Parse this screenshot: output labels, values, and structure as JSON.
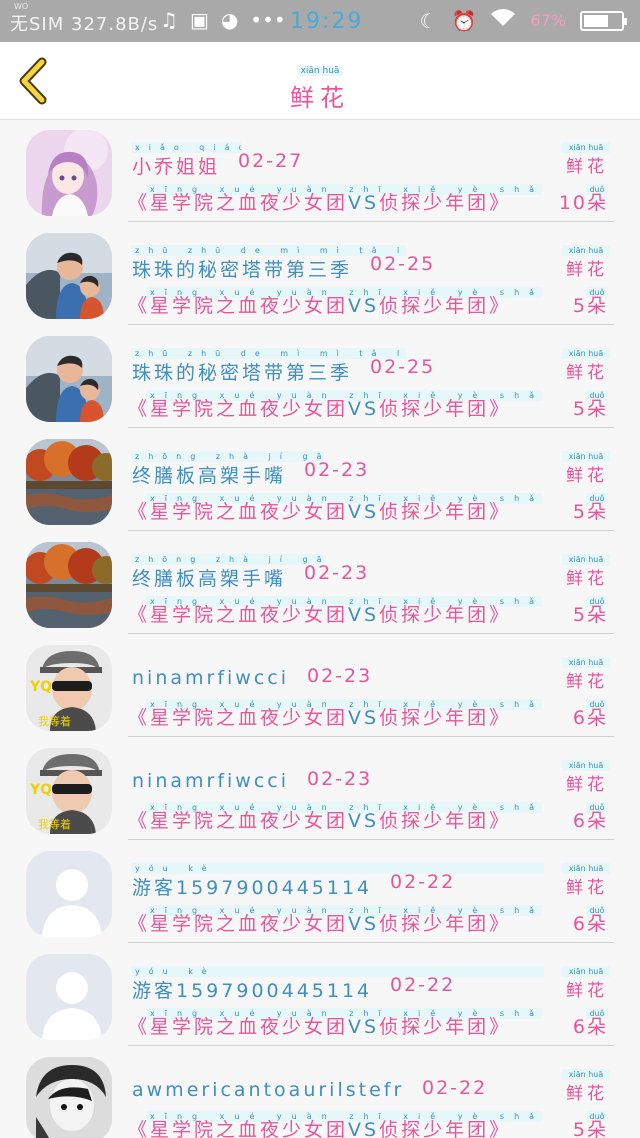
{
  "status_bar": {
    "net_small": "WO",
    "carrier": "无SIM 327.8B/s",
    "time": "19:29",
    "battery_text": "67%",
    "battery_level": 0.67,
    "icons": [
      "music-icon",
      "bag-icon",
      "palette-icon",
      "more-dots-icon",
      "moon-icon",
      "alarm-icon",
      "wifi-icon",
      "battery-icon"
    ]
  },
  "header": {
    "title_pinyin": "xiān  huā",
    "title": "鲜花"
  },
  "labels": {
    "xh_pinyin": "xiān  huā",
    "xh": "鲜花",
    "dou_pinyin": "duǒ"
  },
  "rows": [
    {
      "name": "小乔姐姐",
      "name_pinyin": "xiǎo qiáo jiě jiě",
      "date": "02-27",
      "book": [
        "《星学院之血夜少女团",
        "VS",
        "侦探少年团》"
      ],
      "book_pinyin": "xīng xué yuàn zhī xiě yè shǎo nǚ tuán  zhēn tàn shǎo nián tuán",
      "count": "10朵",
      "avatar": "anime",
      "name_color": "pink"
    },
    {
      "name": "珠珠的秘密塔带第三季",
      "name_pinyin": "zhū zhū de mì mì tǎ luò dì sān jì",
      "date": "02-25",
      "book": [
        "《星学院之血夜少女团",
        "VS",
        "侦探少年团》"
      ],
      "book_pinyin": "xīng xué yuàn zhī xiě yè shǎo nǚ tuán  zhēn tàn shǎo nián tuán",
      "count": "5朵",
      "avatar": "kids",
      "name_color": "blue"
    },
    {
      "name": "珠珠的秘密塔带第三季",
      "name_pinyin": "zhū zhū de mì mì tǎ luò dì sān jì",
      "date": "02-25",
      "book": [
        "《星学院之血夜少女团",
        "VS",
        "侦探少年团》"
      ],
      "book_pinyin": "xīng xué yuàn zhī xiě yè shǎo nǚ tuán  zhēn tàn shǎo nián tuán",
      "count": "5朵",
      "avatar": "kids",
      "name_color": "blue"
    },
    {
      "name": "终膳板高槊手嘴",
      "name_pinyin": "zhōng zhà jí gāo jǔ shǒu rú",
      "date": "02-23",
      "book": [
        "《星学院之血夜少女团",
        "VS",
        "侦探少年团》"
      ],
      "book_pinyin": "xīng xué yuàn zhī xiě yè shǎo nǚ tuán  zhēn tàn shǎo nián tuán",
      "count": "5朵",
      "avatar": "autumn",
      "name_color": "blue"
    },
    {
      "name": "终膳板高槊手嘴",
      "name_pinyin": "zhōng zhà jí gāo jǔ shǒu rú",
      "date": "02-23",
      "book": [
        "《星学院之血夜少女团",
        "VS",
        "侦探少年团》"
      ],
      "book_pinyin": "xīng xué yuàn zhī xiě yè shǎo nǚ tuán  zhēn tàn shǎo nián tuán",
      "count": "5朵",
      "avatar": "autumn",
      "name_color": "blue"
    },
    {
      "name": "ninamrfiwcci",
      "name_pinyin": "",
      "date": "02-23",
      "book": [
        "《星学院之血夜少女团",
        "VS",
        "侦探少年团》"
      ],
      "book_pinyin": "xīng xué yuàn zhī xiě yè shǎo nǚ tuán  zhēn tàn shǎo nián tuán",
      "count": "6朵",
      "avatar": "yq",
      "name_color": "blue"
    },
    {
      "name": "ninamrfiwcci",
      "name_pinyin": "",
      "date": "02-23",
      "book": [
        "《星学院之血夜少女团",
        "VS",
        "侦探少年团》"
      ],
      "book_pinyin": "xīng xué yuàn zhī xiě yè shǎo nǚ tuán  zhēn tàn shǎo nián tuán",
      "count": "6朵",
      "avatar": "yq",
      "name_color": "blue"
    },
    {
      "name": "游客1597900445114",
      "name_pinyin": "yóu kè",
      "date": "02-22",
      "book": [
        "《星学院之血夜少女团",
        "VS",
        "侦探少年团》"
      ],
      "book_pinyin": "xīng xué yuàn zhī xiě yè shǎo nǚ tuán  zhēn tàn shǎo nián tuán",
      "count": "6朵",
      "avatar": "default",
      "name_color": "blue"
    },
    {
      "name": "游客1597900445114",
      "name_pinyin": "yóu kè",
      "date": "02-22",
      "book": [
        "《星学院之血夜少女团",
        "VS",
        "侦探少年团》"
      ],
      "book_pinyin": "xīng xué yuàn zhī xiě yè shǎo nǚ tuán  zhēn tàn shǎo nián tuán",
      "count": "6朵",
      "avatar": "default",
      "name_color": "blue"
    },
    {
      "name": "awmericantoaurilstefr",
      "name_pinyin": "",
      "date": "02-22",
      "book": [
        "《星学院之血夜少女团",
        "VS",
        "侦探少年团》"
      ],
      "book_pinyin": "xīng xué yuàn zhī xiě yè shǎo nǚ tuán  zhēn tàn shǎo nián tuán",
      "count": "5朵",
      "avatar": "bw",
      "name_color": "blue"
    }
  ],
  "avatar_badge": {
    "yq": "YQ",
    "yq_sub": "我等着"
  },
  "colors": {
    "pink": "#e8559a",
    "blue": "#3f8fc0",
    "pinyin_bg": "#e6f7f9",
    "status_bar": "#a9a9a9"
  }
}
